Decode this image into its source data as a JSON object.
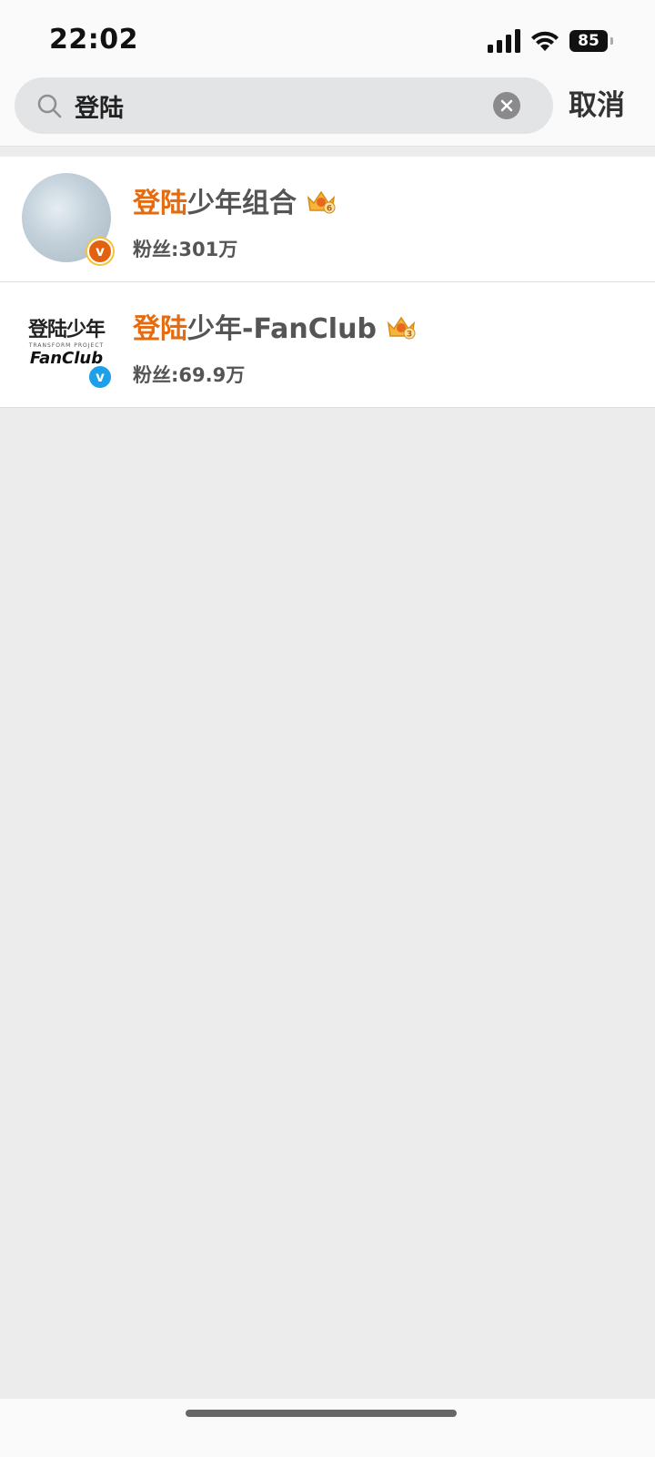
{
  "status_bar": {
    "time": "22:02",
    "battery": "85"
  },
  "search": {
    "query": "登陆",
    "cancel_label": "取消"
  },
  "results": [
    {
      "name_highlight": "登陆",
      "name_rest": "少年组合",
      "level_badge": "6",
      "fans": "粉丝:301万",
      "verify_color": "#e3620d"
    },
    {
      "name_highlight": "登陆",
      "name_rest": "少年-FanClub",
      "level_badge": "3",
      "fans": "粉丝:69.9万",
      "verify_color": "#1da0e8",
      "avatar_logo": {
        "cn": "登陆少年",
        "sub": "TRANSFORM PROJECT",
        "en": "FanClub"
      }
    }
  ],
  "colors": {
    "highlight": "#e46b10",
    "page_bg": "#ececec"
  }
}
